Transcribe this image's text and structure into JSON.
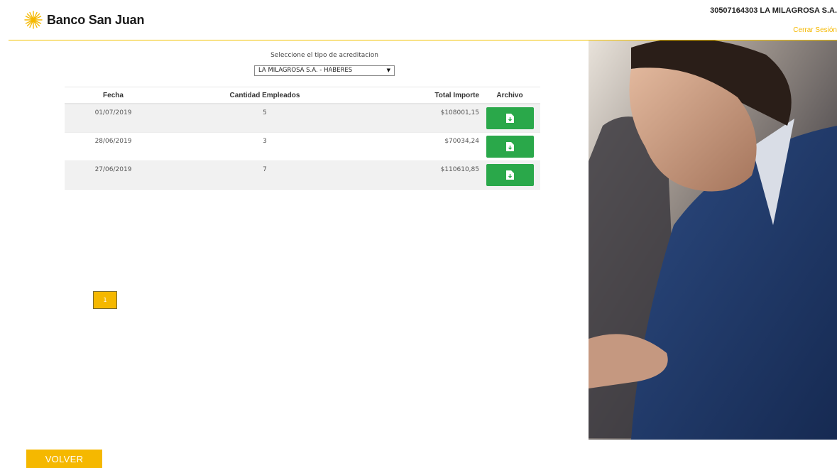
{
  "header": {
    "brand_name": "Banco San Juan",
    "user_name": "30507164303 LA MILAGROSA S.A.",
    "logout_label": "Cerrar Sesión"
  },
  "colors": {
    "accent": "#f5b800",
    "download_green": "#2aa84a"
  },
  "selector": {
    "label": "Seleccione el tipo de acreditacion",
    "selected_value": "LA MILAGROSA S.A. - HABERES"
  },
  "table": {
    "headers": {
      "fecha": "Fecha",
      "cantidad": "Cantidad Empleados",
      "total": "Total Importe",
      "archivo": "Archivo"
    },
    "rows": [
      {
        "fecha": "01/07/2019",
        "cantidad": "5",
        "total": "$108001,15",
        "icon": "file-download-icon"
      },
      {
        "fecha": "28/06/2019",
        "cantidad": "3",
        "total": "$70034,24",
        "icon": "file-download-icon"
      },
      {
        "fecha": "27/06/2019",
        "cantidad": "7",
        "total": "$110610,85",
        "icon": "file-download-icon"
      }
    ]
  },
  "pagination": {
    "current_page": "1"
  },
  "footer": {
    "back_label": "VOLVER"
  },
  "decor": {
    "photo": "businessman-smiling-photo",
    "logo_icon": "star-icon"
  }
}
